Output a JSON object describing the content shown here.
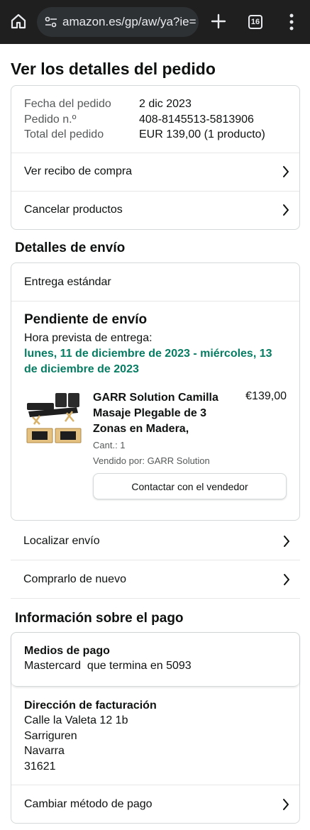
{
  "browser": {
    "url": "amazon.es/gp/aw/ya?ie=",
    "tab_count": "16"
  },
  "page": {
    "title": "Ver los detalles del pedido"
  },
  "order_summary": {
    "rows": [
      {
        "label": "Fecha del pedido",
        "value": "2 dic 2023"
      },
      {
        "label": "Pedido n.º",
        "value": "408-8145513-5813906"
      },
      {
        "label": "Total del pedido",
        "value": "EUR 139,00 (1 producto)"
      }
    ],
    "receipt_link": "Ver recibo de compra",
    "cancel_link": "Cancelar productos"
  },
  "shipping": {
    "section_title": "Detalles de envío",
    "delivery_type": "Entrega estándar",
    "status": "Pendiente de envío",
    "eta_label": "Hora prevista de entrega:",
    "eta_value": "lunes, 11 de diciembre de 2023 - miércoles, 13 de diciembre de 2023",
    "item": {
      "name": "GARR Solution Camilla Masaje Plegable de 3 Zonas en Madera,",
      "price": "€139,00",
      "quantity": "Cant.: 1",
      "seller": "Vendido por: GARR Solution",
      "contact_button": "Contactar con el vendedor"
    },
    "track_link": "Localizar envío",
    "buy_again_link": "Comprarlo de nuevo"
  },
  "payment": {
    "section_title": "Información sobre el pago",
    "method_title": "Medios de pago",
    "method_value": "Mastercard  que termina en 5093",
    "billing_title": "Dirección de facturación",
    "billing_lines": [
      "Calle la Valeta 12 1b",
      "Sarriguren",
      "Navarra",
      "31621"
    ],
    "change_link": "Cambiar método de pago"
  },
  "colors": {
    "eta_green": "#067d62",
    "chrome_bg": "#1f1f1f",
    "border": "#d5d9d9"
  }
}
